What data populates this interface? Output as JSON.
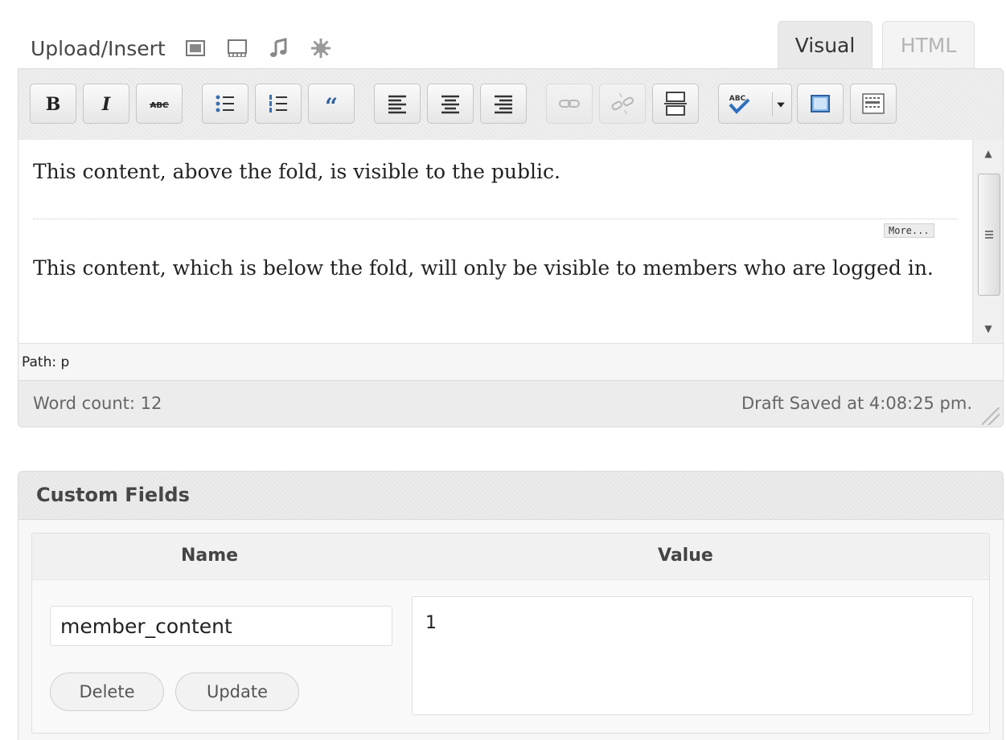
{
  "media": {
    "label": "Upload/Insert",
    "icons": [
      "add-image-icon",
      "add-video-icon",
      "add-audio-icon",
      "add-media-icon"
    ]
  },
  "tabs": {
    "visual": "Visual",
    "html": "HTML"
  },
  "toolbar": {
    "buttons": [
      "bold",
      "italic",
      "strikethrough",
      "unordered-list",
      "ordered-list",
      "blockquote",
      "align-left",
      "align-center",
      "align-right",
      "insert-link",
      "unlink",
      "insert-more-tag",
      "spellcheck",
      "fullscreen",
      "kitchen-sink"
    ],
    "abc_label": "ABC"
  },
  "content": {
    "paragraph1": "This content, above the fold, is visible to the public.",
    "more_label": "More...",
    "paragraph2": "This content, which is below the fold, will only be visible to members who are logged in."
  },
  "path": "Path: p",
  "status": {
    "word_count": "Word count: 12",
    "draft_saved": "Draft Saved at 4:08:25 pm."
  },
  "custom_fields": {
    "title": "Custom Fields",
    "col_name": "Name",
    "col_value": "Value",
    "field_name": "member_content",
    "field_value": "1",
    "delete_label": "Delete",
    "update_label": "Update"
  }
}
